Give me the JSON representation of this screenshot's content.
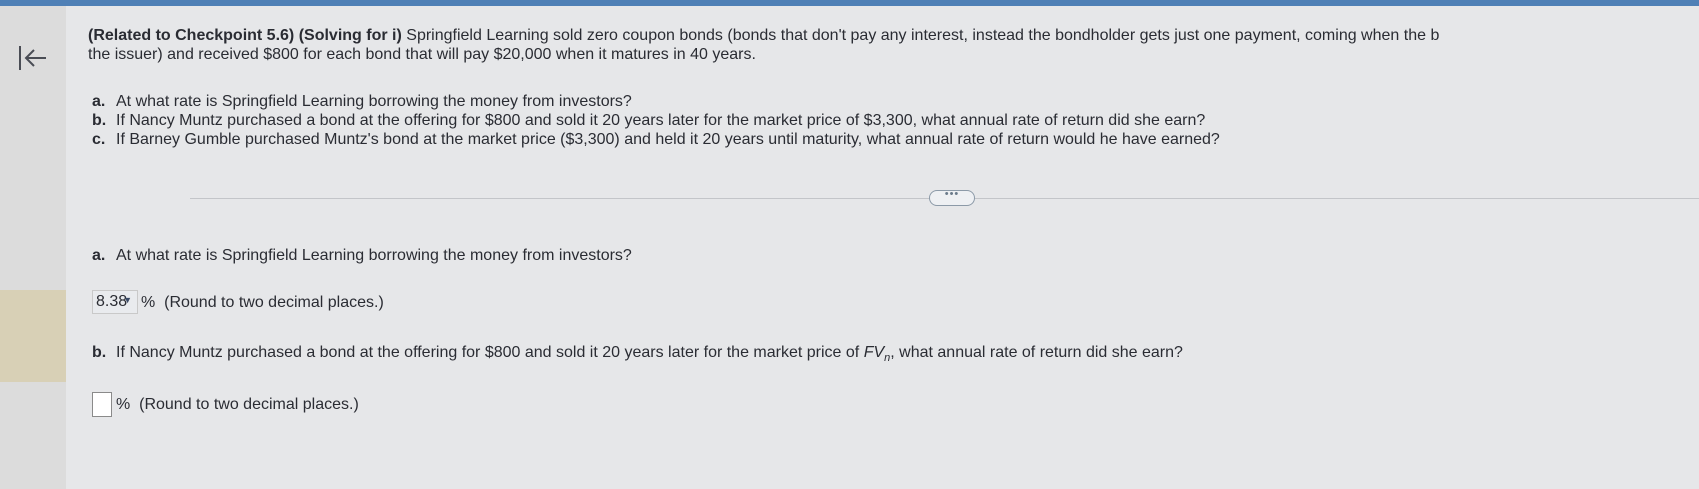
{
  "header": {
    "checkpoint": "(Related to Checkpoint 5.6)",
    "topic": "(Solving for i)",
    "line1_rest": "Springfield Learning sold zero coupon bonds (bonds that don't pay any interest, instead the bondholder gets just one payment, coming when the b",
    "line2": "the issuer) and received $800 for each bond that will pay $20,000 when it matures in 40 years."
  },
  "problem": {
    "items": [
      {
        "label": "a.",
        "text": "At what rate is Springfield Learning borrowing the money from investors?"
      },
      {
        "label": "b.",
        "text": "If Nancy Muntz purchased a bond at the offering for $800 and sold it 20 years later for the market price of $3,300, what annual rate of return did she earn?"
      },
      {
        "label": "c.",
        "text": "If Barney Gumble purchased Muntz's bond at the market price ($3,300) and held it 20 years until maturity, what annual rate of return would he have earned?"
      }
    ]
  },
  "expand_button": "•••",
  "answers": {
    "a": {
      "label": "a.",
      "question": "At what rate is Springfield Learning borrowing the money from investors?",
      "value": "8.38",
      "unit": "%",
      "hint": "(Round to two decimal places.)"
    },
    "b": {
      "label": "b.",
      "question_start": "If Nancy Muntz purchased a bond at the offering for $800 and sold it 20 years later for the market price of",
      "fv": "FV",
      "fv_sub": "n",
      "question_end": ", what annual rate of return did she earn?",
      "value": "",
      "unit": "%",
      "hint": "(Round to two decimal places.)"
    }
  }
}
